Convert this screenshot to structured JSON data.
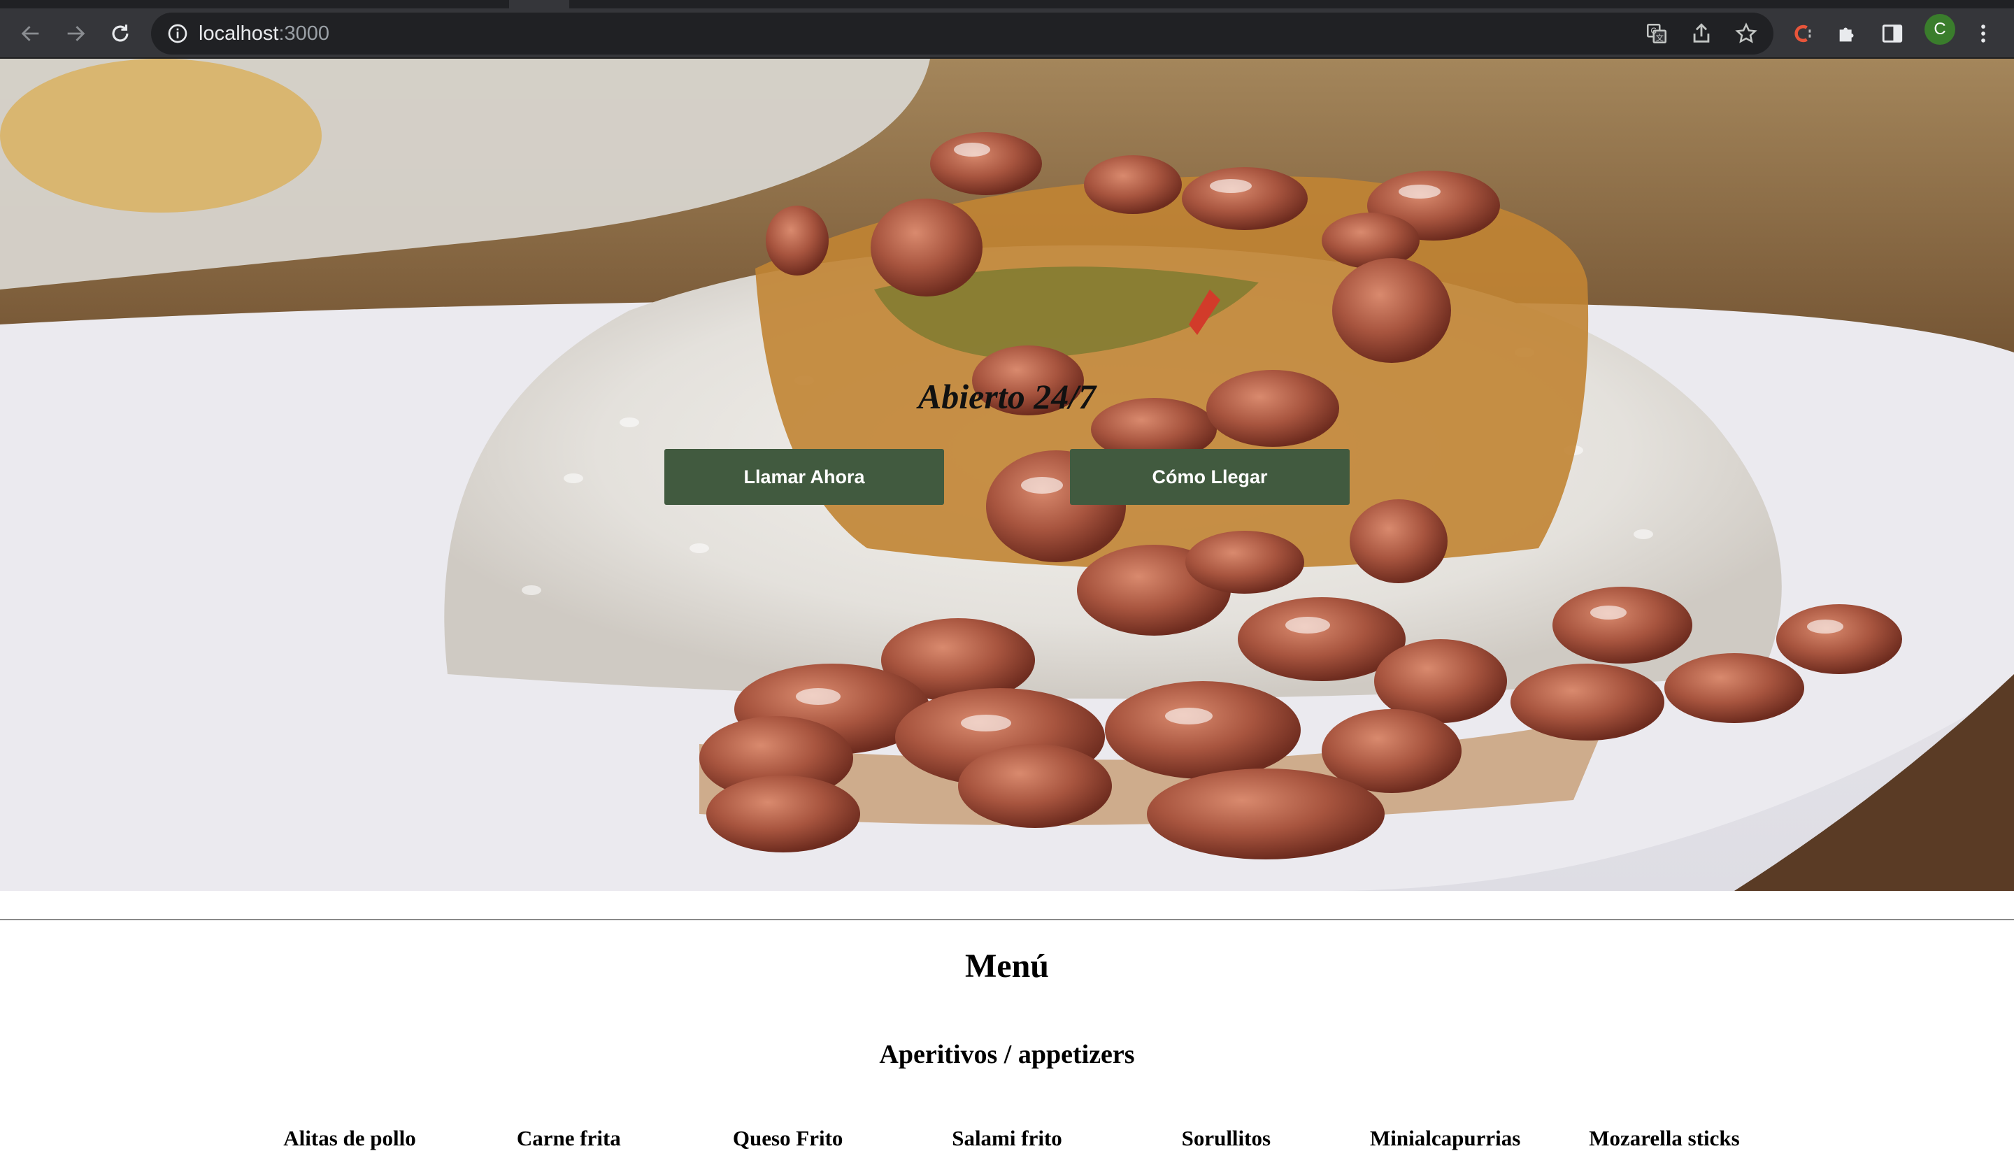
{
  "browser": {
    "url_host": "localhost",
    "url_port": ":3000",
    "profile_initial": "C",
    "icons": [
      "back-icon",
      "forward-icon",
      "reload-icon",
      "info-icon",
      "translate-icon",
      "share-icon",
      "star-icon",
      "extension-c-icon",
      "puzzle-icon",
      "side-panel-icon",
      "kebab-menu-icon"
    ]
  },
  "hero": {
    "title": "Abierto 24/7",
    "call_button": "Llamar Ahora",
    "directions_button": "Cómo Llegar",
    "button_color": "#415a3f"
  },
  "menu": {
    "title": "Menú",
    "section": "Aperitivos / appetizers",
    "items": [
      "Alitas de pollo",
      "Carne frita",
      "Queso Frito",
      "Salami frito",
      "Sorullitos",
      "Minialcapurrias",
      "Mozarella sticks"
    ]
  }
}
